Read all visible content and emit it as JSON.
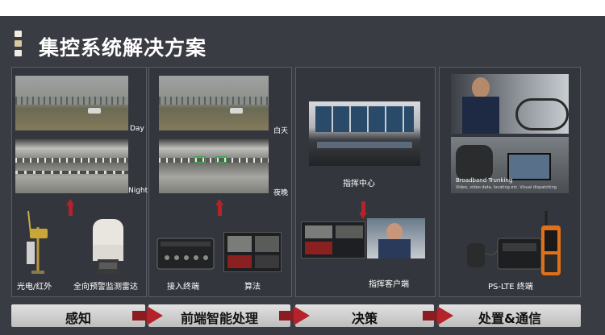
{
  "title": "集控系统解决方案",
  "markers": [
    "#f0ede4",
    "#d8c8a0",
    "#f0ede4"
  ],
  "colors": {
    "accent": "#b4232a",
    "background": "#3a3c43",
    "bar": "#d2d2d2"
  },
  "panels": {
    "perception": {
      "captions": {
        "day": "Day",
        "night": "Night"
      },
      "labels": {
        "camera": "光电/红外",
        "radar": "全向预警监测雷达"
      }
    },
    "edge": {
      "captions": {
        "day": "白天",
        "night": "夜晚"
      },
      "labels": {
        "terminal": "接入终端",
        "algorithm": "算法"
      }
    },
    "decision": {
      "labels": {
        "center": "指挥中心",
        "client": "指挥客户端"
      }
    },
    "dispatch": {
      "overlay": "Broadband Trunking",
      "overlay_sub": "Video, video data, locating etc. Visual dispatching",
      "labels": {
        "pslte": "PS-LTE 终端"
      }
    }
  },
  "bars": [
    "感知",
    "前端智能处理",
    "决策",
    "处置&通信"
  ]
}
